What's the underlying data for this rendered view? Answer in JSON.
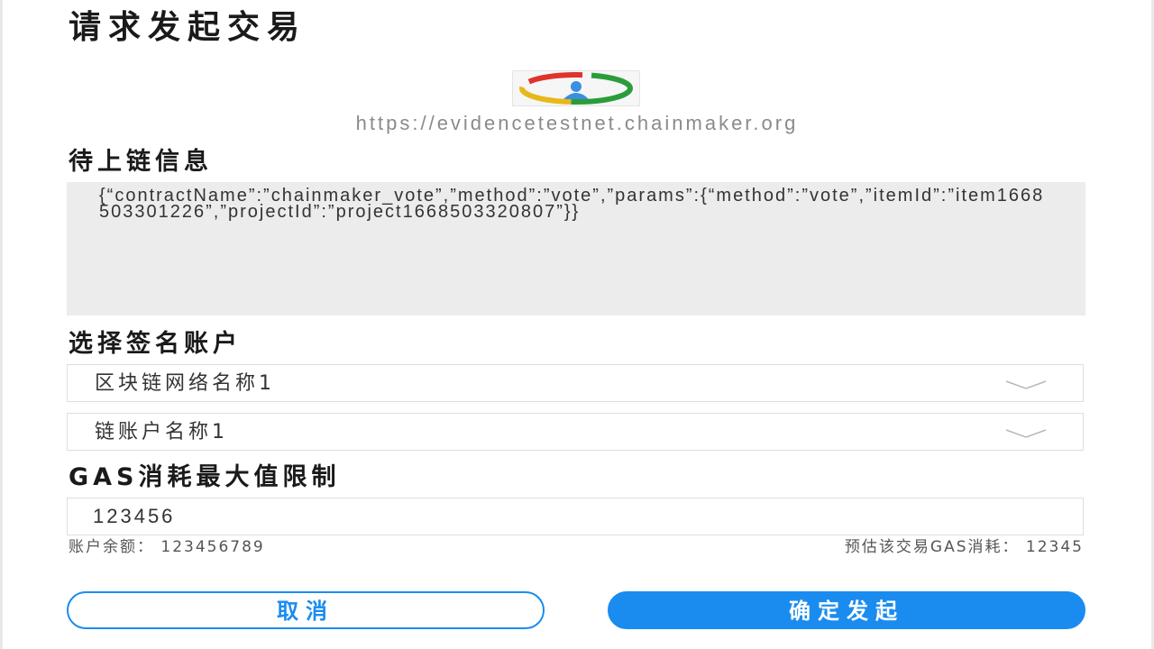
{
  "page": {
    "title": "请求发起交易"
  },
  "site": {
    "logo_icon": "chainmaker-logo-icon",
    "url": "https://evidencetestnet.chainmaker.org"
  },
  "pending": {
    "label": "待上链信息",
    "content": "{“contractName”:”chainmaker_vote”,”method”:”vote”,”params”:{“method”:”vote”,”itemId”:”item1668503301226”,”projectId”:”project1668503320807”}}"
  },
  "account": {
    "label": "选择签名账户",
    "network_select": "区块链网络名称1",
    "account_select": "链账户名称1",
    "chevron_icon": "chevron-down-icon"
  },
  "gas": {
    "label": "GAS消耗最大值限制",
    "value": "123456",
    "balance_text": "账户余额： 123456789",
    "estimate_text": "预估该交易GAS消耗： 12345"
  },
  "actions": {
    "cancel_label": "取消",
    "confirm_label": "确定发起"
  },
  "colors": {
    "accent": "#1a8cf0",
    "panel_bg": "#ececec"
  }
}
